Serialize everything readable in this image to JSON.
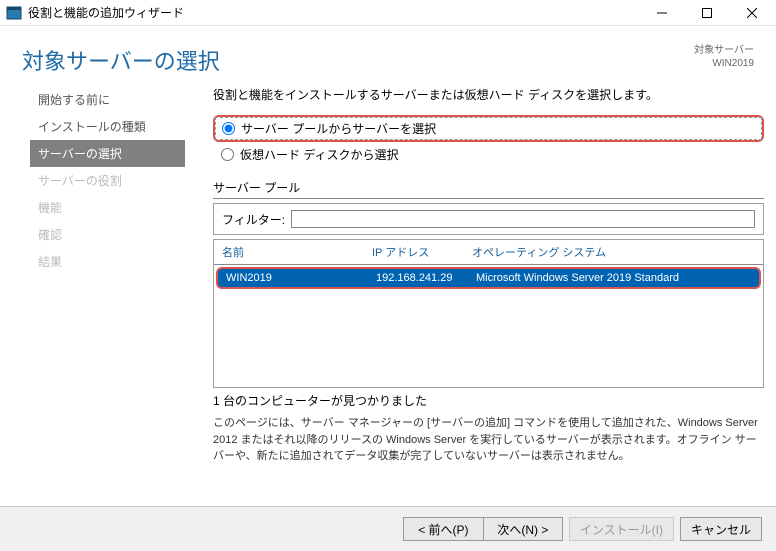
{
  "titlebar": {
    "title": "役割と機能の追加ウィザード"
  },
  "header": {
    "title": "対象サーバーの選択",
    "target_label": "対象サーバー",
    "target_value": "WIN2019"
  },
  "sidebar": {
    "items": [
      {
        "label": "開始する前に",
        "active": false,
        "disabled": false
      },
      {
        "label": "インストールの種類",
        "active": false,
        "disabled": false
      },
      {
        "label": "サーバーの選択",
        "active": true,
        "disabled": false
      },
      {
        "label": "サーバーの役割",
        "active": false,
        "disabled": true
      },
      {
        "label": "機能",
        "active": false,
        "disabled": true
      },
      {
        "label": "確認",
        "active": false,
        "disabled": true
      },
      {
        "label": "結果",
        "active": false,
        "disabled": true
      }
    ]
  },
  "main": {
    "instruction": "役割と機能をインストールするサーバーまたは仮想ハード ディスクを選択します。",
    "radio_option1": "サーバー プールからサーバーを選択",
    "radio_option2": "仮想ハード ディスクから選択",
    "pool_label": "サーバー プール",
    "filter_label": "フィルター:",
    "filter_value": "",
    "table": {
      "columns": {
        "name": "名前",
        "ip": "IP アドレス",
        "os": "オペレーティング システム"
      },
      "rows": [
        {
          "name": "WIN2019",
          "ip": "192.168.241.29",
          "os": "Microsoft Windows Server 2019 Standard"
        }
      ]
    },
    "count_label": "1 台のコンピューターが見つかりました",
    "description": "このページには、サーバー マネージャーの [サーバーの追加] コマンドを使用して追加された、Windows Server 2012 またはそれ以降のリリースの Windows Server を実行しているサーバーが表示されます。オフライン サーバーや、新たに追加されてデータ収集が完了していないサーバーは表示されません。"
  },
  "footer": {
    "prev": "< 前へ(P)",
    "next": "次へ(N) >",
    "install": "インストール(I)",
    "cancel": "キャンセル"
  }
}
